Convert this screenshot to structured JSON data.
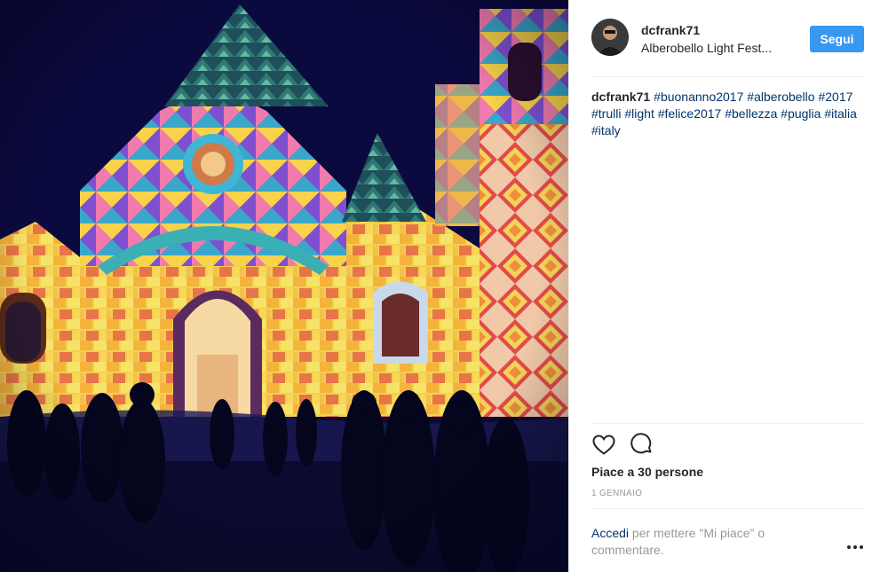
{
  "post": {
    "author": {
      "username": "dcfrank71",
      "location": "Alberobello Light Fest..."
    },
    "follow_label": "Segui",
    "caption": {
      "username": "dcfrank71",
      "hashtags": [
        "#buonanno2017",
        "#alberobello",
        "#2017",
        "#trulli",
        "#light",
        "#felice2017",
        "#bellezza",
        "#puglia",
        "#italia",
        "#italy"
      ]
    },
    "actions": {
      "like_icon": "heart-icon",
      "comment_icon": "comment-icon"
    },
    "likes_text": "Piace a 30 persone",
    "date": "1 GENNAIO",
    "login_prompt": {
      "link": "Accedi",
      "rest": "per mettere \"Mi piace\" o commentare."
    },
    "more_icon": "more-options-icon"
  },
  "colors": {
    "follow_button": "#3897f0",
    "hashtag": "#003569",
    "muted": "#999999",
    "text": "#262626"
  }
}
